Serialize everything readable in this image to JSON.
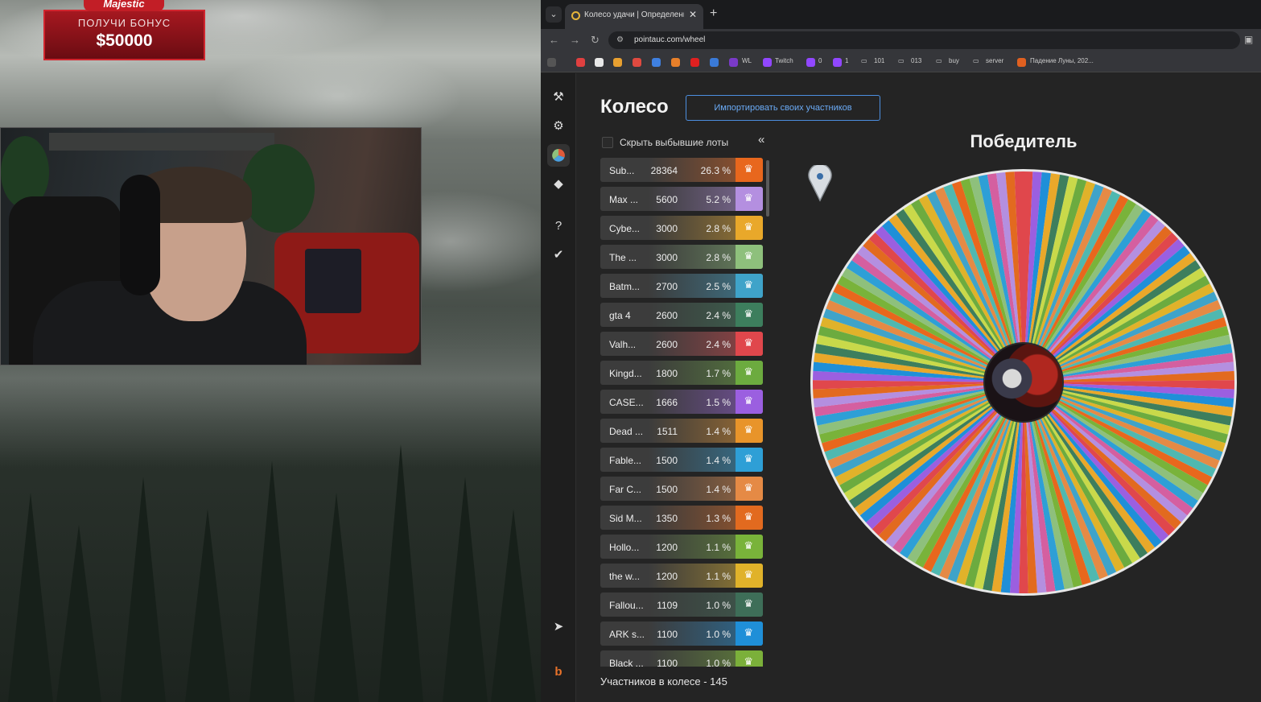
{
  "stream": {
    "promo": {
      "brand": "Majestic",
      "bonus_label": "ПОЛУЧИ БОНУС",
      "amount": "$50000"
    }
  },
  "browser": {
    "tab_title": "Колесо удачи | Определение по",
    "url": "pointauc.com/wheel",
    "bookmarks": [
      "WL",
      "Twitch",
      "0",
      "1",
      "101",
      "013",
      "buy",
      "server",
      "Падение Луны, 202..."
    ]
  },
  "app": {
    "title": "Колесо",
    "import_button": "Импортировать своих участников",
    "hide_label": "Скрыть выбывшие лоты",
    "participants_label": "Участников в колесе - 145",
    "winner_label": "Победитель",
    "accent": "#4c8fe0",
    "lots": [
      {
        "name": "Sub...",
        "amount": "28364",
        "percent": "26.3 %",
        "color": "#e8671d"
      },
      {
        "name": "Max ...",
        "amount": "5600",
        "percent": "5.2 %",
        "color": "#b48fe0"
      },
      {
        "name": "Cybe...",
        "amount": "3000",
        "percent": "2.8 %",
        "color": "#e9a82a"
      },
      {
        "name": "The ...",
        "amount": "3000",
        "percent": "2.8 %",
        "color": "#8ec07c"
      },
      {
        "name": "Batm...",
        "amount": "2700",
        "percent": "2.5 %",
        "color": "#3fa3c9"
      },
      {
        "name": "gta 4",
        "amount": "2600",
        "percent": "2.4 %",
        "color": "#3d7e5d"
      },
      {
        "name": "Valh...",
        "amount": "2600",
        "percent": "2.4 %",
        "color": "#e0474c"
      },
      {
        "name": "Kingd...",
        "amount": "1800",
        "percent": "1.7 %",
        "color": "#6cab3f"
      },
      {
        "name": "CASE...",
        "amount": "1666",
        "percent": "1.5 %",
        "color": "#9b5fe0"
      },
      {
        "name": "Dead ...",
        "amount": "1511",
        "percent": "1.4 %",
        "color": "#e8942a"
      },
      {
        "name": "Fable...",
        "amount": "1500",
        "percent": "1.4 %",
        "color": "#2e9fd6"
      },
      {
        "name": "Far C...",
        "amount": "1500",
        "percent": "1.4 %",
        "color": "#e58a45"
      },
      {
        "name": "Sid M...",
        "amount": "1350",
        "percent": "1.3 %",
        "color": "#e26a1f"
      },
      {
        "name": "Hollo...",
        "amount": "1200",
        "percent": "1.1 %",
        "color": "#79b33a"
      },
      {
        "name": "the w...",
        "amount": "1200",
        "percent": "1.1 %",
        "color": "#e0b22a"
      },
      {
        "name": "Fallou...",
        "amount": "1109",
        "percent": "1.0 %",
        "color": "#3e6e58"
      },
      {
        "name": "ARK s...",
        "amount": "1100",
        "percent": "1.0 %",
        "color": "#1f8fd8"
      },
      {
        "name": "Black ...",
        "amount": "1100",
        "percent": "1.0 %",
        "color": "#7bb03a"
      }
    ],
    "wheel_colors": [
      "#e0474c",
      "#8ec07c",
      "#3fa3c9",
      "#e9a82a",
      "#b48fe0",
      "#e8671d",
      "#6cab3f",
      "#9b5fe0",
      "#2e9fd6",
      "#e58a45",
      "#3d7e5d",
      "#e26a1f",
      "#79b33a",
      "#e0b22a",
      "#1f8fd8",
      "#d45fa0",
      "#4fb8b0",
      "#c9d94a"
    ]
  }
}
